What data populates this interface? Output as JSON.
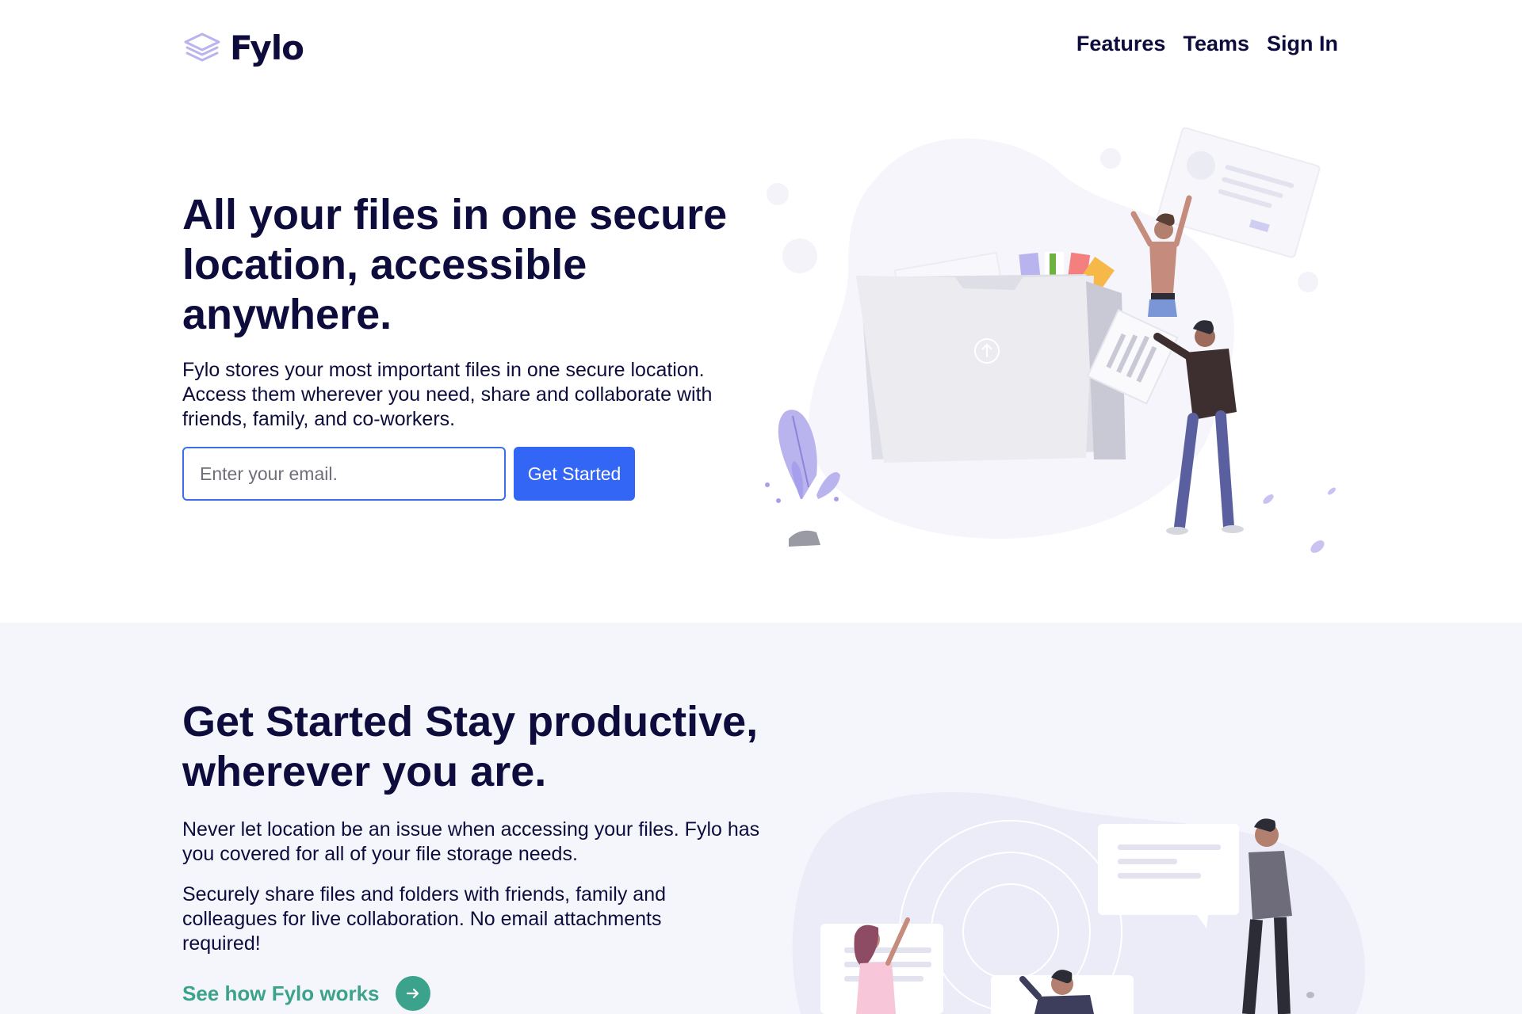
{
  "header": {
    "logo_text": "Fylo",
    "nav": [
      {
        "label": "Features"
      },
      {
        "label": "Teams"
      },
      {
        "label": "Sign In"
      }
    ]
  },
  "hero": {
    "title": "All your files in one secure location, accessible anywhere.",
    "text": "Fylo stores your most important files in one secure location. Access them wherever you need, share and collaborate with friends, family, and co-workers.",
    "email_placeholder": "Enter your email.",
    "cta_label": "Get Started"
  },
  "section2": {
    "title": "Get Started Stay productive, wherever you are.",
    "p1": "Never let location be an issue when accessing your files. Fylo has you covered for all of your file storage needs.",
    "p2": "Securely share files and folders with friends, family and colleagues for live collaboration. No email attachments required!",
    "link_text": "See how Fylo works"
  },
  "colors": {
    "navy": "#0d0c3d",
    "button_blue": "#3466f6",
    "teal": "#3ba38c",
    "section_bg": "#f5f6fc"
  },
  "icons": {
    "logo": "stacked-layers-icon",
    "link_arrow": "arrow-right-icon",
    "folder_upload": "upload-arrow-icon"
  }
}
